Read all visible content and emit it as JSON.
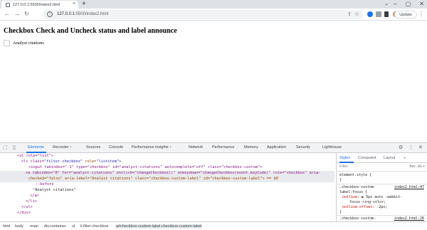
{
  "browser": {
    "tab_title": "127.0.0.1:5500/index2.html",
    "url_host": "127.0.0.1",
    "url_rest": ":5500/index2.html",
    "update_label": "Update",
    "new_tab_glyph": "+"
  },
  "page": {
    "heading": "Checkbox Check and Uncheck status and label announce",
    "checkbox_label": "Analyst citations"
  },
  "devtools": {
    "tabs": [
      "Elements",
      "Recorder ↑",
      "Sources",
      "Console",
      "Performance insights ↑",
      "Network",
      "Performance",
      "Memory",
      "Application",
      "Security",
      "Lighthouse"
    ],
    "elements_lines": [
      {
        "indent": 0,
        "html": "ul_open"
      },
      {
        "indent": 1,
        "html": "li_open"
      },
      {
        "indent": 2,
        "html": "input"
      },
      {
        "indent": 2,
        "html": "a_open"
      },
      {
        "indent": 3,
        "html": "a_cont"
      },
      {
        "indent": 3,
        "html": "before"
      },
      {
        "indent": 3,
        "html": "text"
      },
      {
        "indent": 2,
        "html": "a_close"
      },
      {
        "indent": 1,
        "html": "li_close"
      },
      {
        "indent": 0,
        "html": "ul_close"
      },
      {
        "indent": 0,
        "html": "div_close"
      }
    ],
    "dom": {
      "ul_open": "<ul role=\"list\">",
      "li_open_pre": "<li class=",
      "li_open_cls": "\"filter-checkbox\"",
      "li_open_role": " role=",
      "li_open_role_val": "\"listitem\">",
      "input": "<input tabindex=\"-1\" type=\"checkbox\" id=\"analyst-citations\" autocomplete=\"off\" class=\"checkbox-custom\">",
      "a_open": "<a tabindex=\"0\" for=\"analyst-citations\" onclick=\"changeCheckbox()\" onkeydown=\"changeCheckbox(event.keyCode)\" role=\"checkbox\" aria-",
      "a_cont": "checked=\"false\" aria-label=\"Analyst citations\" class=\"checkbox-custom-label\" id=\"checkbox-custom-label\"> == $0",
      "before": "::before",
      "text": "\"Analyst citations\"",
      "a_close": "</a>",
      "li_close": "</li>",
      "ul_close": "</ul>",
      "div_close": "</div>"
    },
    "styles_tabs": [
      "Styles",
      "Computed",
      "Layout"
    ],
    "filter_placeholder": "Filter",
    "filter_tools": ":hov  .cls  +",
    "element_style": "element.style {",
    "close_brace": "}",
    "rule1_selector": ".checkbox-custom-",
    "rule1_selector2": "label:focus {",
    "rule1_src": "index2.html:47",
    "rule1_prop1": "outline",
    "rule1_val1": ": ▶ 5px auto -webkit-",
    "rule1_val1b": "focus-ring-color;",
    "rule1_prop2": "outline-offset",
    "rule1_val2": ": -2px;",
    "rule2_selector": ".checkbox-custom-",
    "rule2_selector2": "label {",
    "rule2_src": "index2.html:26",
    "breadcrumbs": [
      "html",
      "body",
      "main",
      "div.container",
      "ul",
      "li.filter-checkbox",
      "a#checkbox-custom-label.checkbox-custom-label"
    ]
  },
  "colors": {
    "accent": "#1a73e8",
    "tag": "#881280",
    "attr": "#994500",
    "value": "#1a1aa6"
  }
}
